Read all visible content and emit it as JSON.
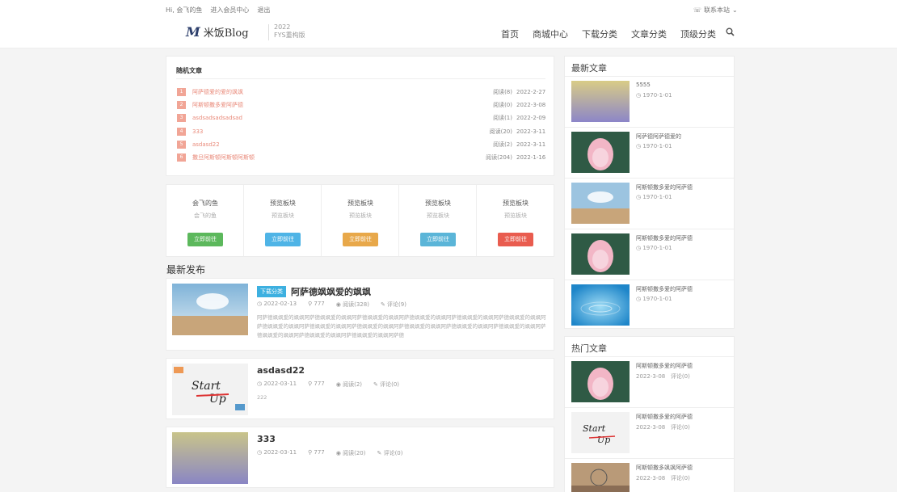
{
  "topbar": {
    "links": [
      "Hi, 会飞的鱼",
      "进入会员中心",
      "退出"
    ],
    "contact": "联系本站"
  },
  "header": {
    "logo_mark": "M",
    "logo_text": "米饭Blog",
    "year": "2022",
    "edition": "FYS重构版",
    "nav": [
      "首页",
      "商城中心",
      "下载分类",
      "文章分类",
      "顶级分类"
    ]
  },
  "random_articles": {
    "title": "随机文章",
    "items": [
      {
        "num": "1",
        "title": "阿萨德爱的爱的飒飒",
        "views": "阅读(8)",
        "date": "2022-2-27"
      },
      {
        "num": "2",
        "title": "阿斯顿撒多爱阿萨德",
        "views": "阅读(0)",
        "date": "2022-3-08"
      },
      {
        "num": "3",
        "title": "asdsadsadsadsad",
        "views": "阅读(1)",
        "date": "2022-2-09"
      },
      {
        "num": "4",
        "title": "333",
        "views": "阅读(20)",
        "date": "2022-3-11"
      },
      {
        "num": "5",
        "title": "asdasd22",
        "views": "阅读(2)",
        "date": "2022-3-11"
      },
      {
        "num": "6",
        "title": "撒旦阿斯顿阿斯顿阿斯顿",
        "views": "阅读(204)",
        "date": "2022-1-16"
      }
    ]
  },
  "blocks": [
    {
      "title": "会飞的鱼",
      "sub": "会飞的鱼",
      "btn": "立即前往",
      "color": "#5cb85c"
    },
    {
      "title": "预览板块",
      "sub": "预览板块",
      "btn": "立即前往",
      "color": "#4fb4e6"
    },
    {
      "title": "预览板块",
      "sub": "预览板块",
      "btn": "立即前往",
      "color": "#e8a84a"
    },
    {
      "title": "预览板块",
      "sub": "预览板块",
      "btn": "立即前往",
      "color": "#5bb5d8"
    },
    {
      "title": "预览板块",
      "sub": "预览板块",
      "btn": "立即前往",
      "color": "#e95c4f"
    }
  ],
  "latest_posts": {
    "title": "最新发布",
    "items": [
      {
        "tag": "下载分类",
        "title": "阿萨德飒飒爱的飒飒",
        "date": "2022-02-13",
        "author": "777",
        "views": "阅读(328)",
        "comments": "评论(9)",
        "desc": "阿萨德飒飒爱的飒飒阿萨德飒飒爱的飒飒阿萨德飒飒爱的飒飒阿萨德飒飒爱的飒飒阿萨德飒飒爱的飒飒阿萨德飒飒爱的飒飒阿萨德飒飒爱的飒飒阿萨德飒飒爱的飒飒阿萨德飒飒爱的飒飒阿萨德飒飒爱的飒飒阿萨德飒飒爱的飒飒阿萨德飒飒爱的飒飒阿萨德飒飒爱的飒飒阿萨德飒飒爱的飒飒阿萨德飒飒爱的飒飒阿萨德"
      },
      {
        "tag": "",
        "title": "asdasd22",
        "date": "2022-03-11",
        "author": "777",
        "views": "阅读(2)",
        "comments": "评论(0)",
        "desc": "222"
      },
      {
        "tag": "",
        "title": "333",
        "date": "2022-03-11",
        "author": "777",
        "views": "阅读(20)",
        "comments": "评论(0)",
        "desc": ""
      }
    ]
  },
  "sidebar_latest": {
    "title": "最新文章",
    "items": [
      {
        "title": "5555",
        "date": "1970-1-01"
      },
      {
        "title": "阿萨德阿萨德爱的",
        "date": "1970-1-01"
      },
      {
        "title": "阿斯顿撒多爱的阿萨德",
        "date": "1970-1-01"
      },
      {
        "title": "阿斯顿撒多爱的阿萨德",
        "date": "1970-1-01"
      },
      {
        "title": "阿斯顿撒多爱的阿萨德",
        "date": "1970-1-01"
      }
    ]
  },
  "sidebar_hot": {
    "title": "热门文章",
    "items": [
      {
        "title": "阿斯顿撒多爱的阿萨德",
        "date": "2022-3-08",
        "comments": "评论(0)"
      },
      {
        "title": "阿斯顿撒多爱的阿萨德",
        "date": "2022-3-08",
        "comments": "评论(0)"
      },
      {
        "title": "阿斯顿撒多飒飒阿萨德",
        "date": "2022-3-08",
        "comments": "评论(0)"
      }
    ]
  }
}
